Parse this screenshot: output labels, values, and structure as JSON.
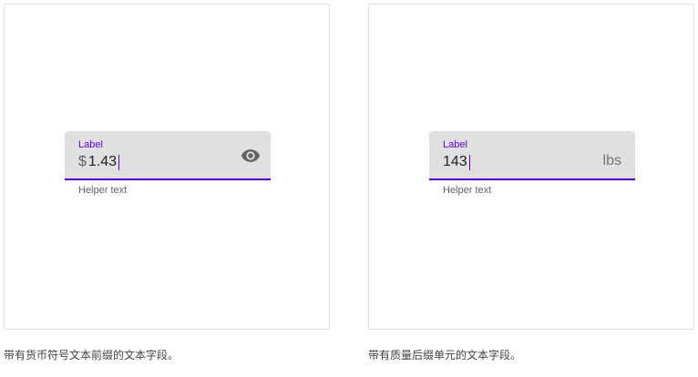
{
  "left_demo": {
    "field": {
      "label": "Label",
      "prefix": "$",
      "value": "1.43",
      "trailing_icon": "eye-icon"
    },
    "helper_text": "Helper text",
    "caption": "带有货币符号文本前缀的文本字段。"
  },
  "right_demo": {
    "field": {
      "label": "Label",
      "value": "143",
      "suffix": "lbs"
    },
    "helper_text": "Helper text",
    "caption": "带有质量后缀单元的文本字段。"
  },
  "colors": {
    "accent": "#6200ee",
    "field_fill": "#e0e0e0",
    "panel_border": "#e0e0e0"
  }
}
